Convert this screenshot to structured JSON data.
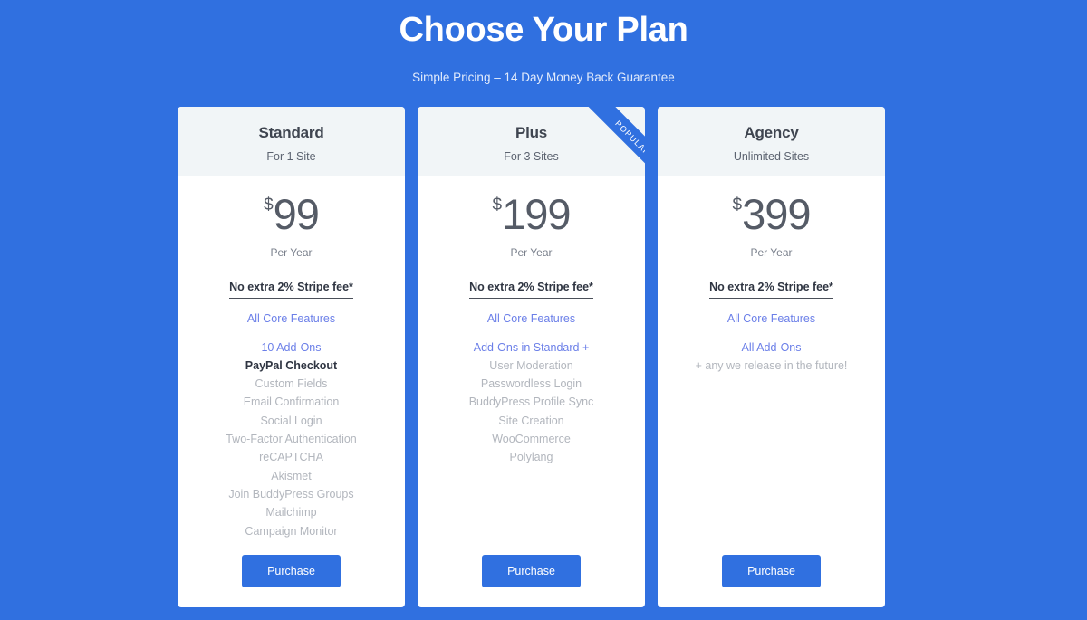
{
  "header": {
    "title": "Choose Your Plan",
    "subtitle": "Simple Pricing – 14 Day Money Back Guarantee"
  },
  "colors": {
    "background_blue": "#3070e0",
    "card_white": "#ffffff",
    "card_header": "#f1f5f7",
    "link_blue": "#6b7fe8",
    "feature_gray": "#b2b6bd",
    "heading_dark": "#2f3542"
  },
  "ribbon": {
    "label": "POPULAR"
  },
  "plans": [
    {
      "name": "Standard",
      "sites": "For 1 Site",
      "currency": "$",
      "amount": "99",
      "period": "Per Year",
      "stripe_note": "No extra 2% Stripe fee*",
      "features": [
        {
          "label": "All Core Features",
          "style": "link"
        },
        {
          "label": "10 Add-Ons",
          "style": "link-spaced"
        },
        {
          "label": "PayPal Checkout",
          "style": "strong"
        },
        {
          "label": "Custom Fields",
          "style": "normal"
        },
        {
          "label": "Email Confirmation",
          "style": "normal"
        },
        {
          "label": "Social Login",
          "style": "normal"
        },
        {
          "label": "Two-Factor Authentication",
          "style": "normal"
        },
        {
          "label": "reCAPTCHA",
          "style": "normal"
        },
        {
          "label": "Akismet",
          "style": "normal"
        },
        {
          "label": "Join BuddyPress Groups",
          "style": "normal"
        },
        {
          "label": "Mailchimp",
          "style": "normal"
        },
        {
          "label": "Campaign Monitor",
          "style": "normal"
        }
      ],
      "cta": "Purchase",
      "popular": false
    },
    {
      "name": "Plus",
      "sites": "For 3 Sites",
      "currency": "$",
      "amount": "199",
      "period": "Per Year",
      "stripe_note": "No extra 2% Stripe fee*",
      "features": [
        {
          "label": "All Core Features",
          "style": "link"
        },
        {
          "label": "Add-Ons in Standard +",
          "style": "link-spaced"
        },
        {
          "label": "User Moderation",
          "style": "normal"
        },
        {
          "label": "Passwordless Login",
          "style": "normal"
        },
        {
          "label": "BuddyPress Profile Sync",
          "style": "normal"
        },
        {
          "label": "Site Creation",
          "style": "normal"
        },
        {
          "label": "WooCommerce",
          "style": "normal"
        },
        {
          "label": "Polylang",
          "style": "normal"
        }
      ],
      "cta": "Purchase",
      "popular": true
    },
    {
      "name": "Agency",
      "sites": "Unlimited Sites",
      "currency": "$",
      "amount": "399",
      "period": "Per Year",
      "stripe_note": "No extra 2% Stripe fee*",
      "features": [
        {
          "label": "All Core Features",
          "style": "link"
        },
        {
          "label": "All Add-Ons",
          "style": "link-spaced"
        },
        {
          "label": "+ any we release in the future!",
          "style": "normal"
        }
      ],
      "cta": "Purchase",
      "popular": false
    }
  ]
}
